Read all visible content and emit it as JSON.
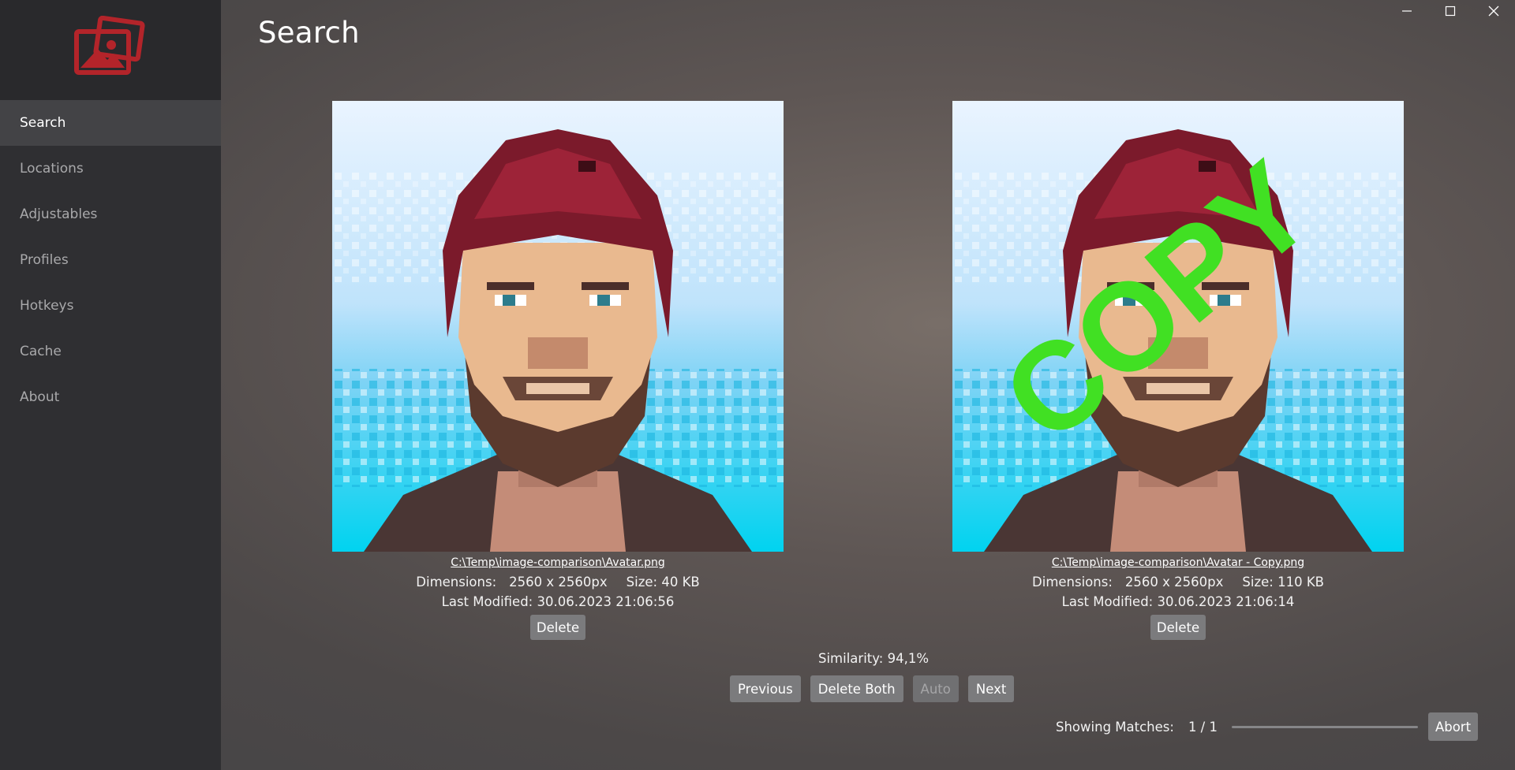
{
  "colors": {
    "sidebar_bg": "#2f2f32",
    "sidebar_active": "#434346",
    "button_bg": "#7b7b7d",
    "logo_red": "#b3242a",
    "copy_watermark": "#41e023"
  },
  "window": {
    "controls": [
      "minimize-icon",
      "maximize-icon",
      "close-icon"
    ]
  },
  "sidebar": {
    "logo_icon": "image-stack-icon",
    "items": [
      {
        "label": "Search",
        "active": true
      },
      {
        "label": "Locations",
        "active": false
      },
      {
        "label": "Adjustables",
        "active": false
      },
      {
        "label": "Profiles",
        "active": false
      },
      {
        "label": "Hotkeys",
        "active": false
      },
      {
        "label": "Cache",
        "active": false
      },
      {
        "label": "About",
        "active": false
      }
    ]
  },
  "header": {
    "title": "Search"
  },
  "left_image": {
    "path": "C:\\Temp\\image-comparison\\Avatar.png",
    "dimensions_label": "Dimensions:",
    "dimensions": "2560 x 2560px",
    "size_label": "Size:",
    "size": "40 KB",
    "modified_label": "Last Modified:",
    "modified": "30.06.2023 21:06:56",
    "delete_label": "Delete"
  },
  "right_image": {
    "path": "C:\\Temp\\image-comparison\\Avatar - Copy.png",
    "dimensions_label": "Dimensions:",
    "dimensions": "2560 x 2560px",
    "size_label": "Size:",
    "size": "110 KB",
    "modified_label": "Last Modified:",
    "modified": "30.06.2023 21:06:14",
    "delete_label": "Delete",
    "watermark": "COPY"
  },
  "comparison": {
    "similarity_label": "Similarity:",
    "similarity_value": "94,1%"
  },
  "actions": {
    "previous": "Previous",
    "delete_both": "Delete Both",
    "auto": "Auto",
    "next": "Next"
  },
  "status": {
    "matches_label": "Showing Matches:",
    "matches_value": "1 / 1",
    "progress": 0,
    "abort": "Abort"
  }
}
